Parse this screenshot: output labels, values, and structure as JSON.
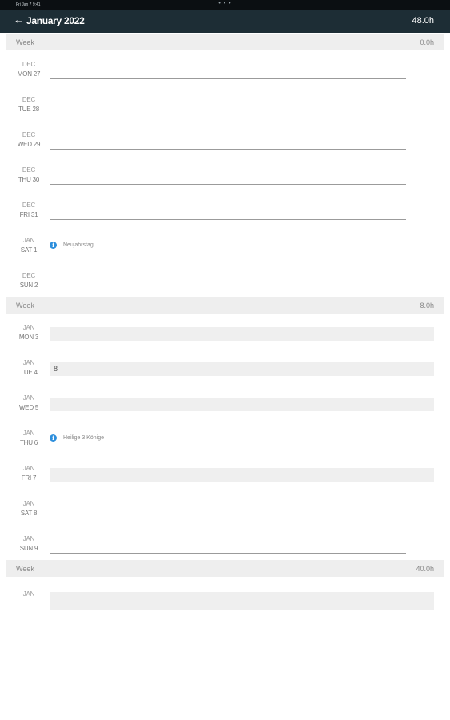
{
  "status_bar": {
    "time": "Fri Jan 7 9:41",
    "dots": "• • •"
  },
  "header": {
    "title": "January 2022",
    "total": "48.0h",
    "back_icon": "arrow-left-icon"
  },
  "weeks": [
    {
      "label": "Week",
      "hours": "0.0h",
      "days": [
        {
          "month": "DEC",
          "day": "MON 27",
          "kind": "line"
        },
        {
          "month": "DEC",
          "day": "TUE 28",
          "kind": "line"
        },
        {
          "month": "DEC",
          "day": "WED 29",
          "kind": "line"
        },
        {
          "month": "DEC",
          "day": "THU 30",
          "kind": "line"
        },
        {
          "month": "DEC",
          "day": "FRI 31",
          "kind": "line"
        },
        {
          "month": "JAN",
          "day": "SAT 1",
          "kind": "holiday",
          "holiday": "Neujahrstag"
        },
        {
          "month": "DEC",
          "day": "SUN 2",
          "kind": "line"
        }
      ]
    },
    {
      "label": "Week",
      "hours": "8.0h",
      "days": [
        {
          "month": "JAN",
          "day": "MON 3",
          "kind": "field",
          "value": ""
        },
        {
          "month": "JAN",
          "day": "TUE 4",
          "kind": "field",
          "value": "8"
        },
        {
          "month": "JAN",
          "day": "WED 5",
          "kind": "field",
          "value": ""
        },
        {
          "month": "JAN",
          "day": "THU 6",
          "kind": "holiday",
          "holiday": "Heilige 3 Könige"
        },
        {
          "month": "JAN",
          "day": "FRI 7",
          "kind": "field",
          "value": ""
        },
        {
          "month": "JAN",
          "day": "SAT 8",
          "kind": "line"
        },
        {
          "month": "JAN",
          "day": "SUN 9",
          "kind": "line"
        }
      ]
    },
    {
      "label": "Week",
      "hours": "40.0h",
      "days": [
        {
          "month": "JAN",
          "day": "",
          "kind": "field",
          "value": ""
        }
      ]
    }
  ],
  "colors": {
    "appbar": "#1d2d35",
    "info": "#2e8fdc",
    "week_band": "#eeeeee",
    "field": "#efefef"
  }
}
